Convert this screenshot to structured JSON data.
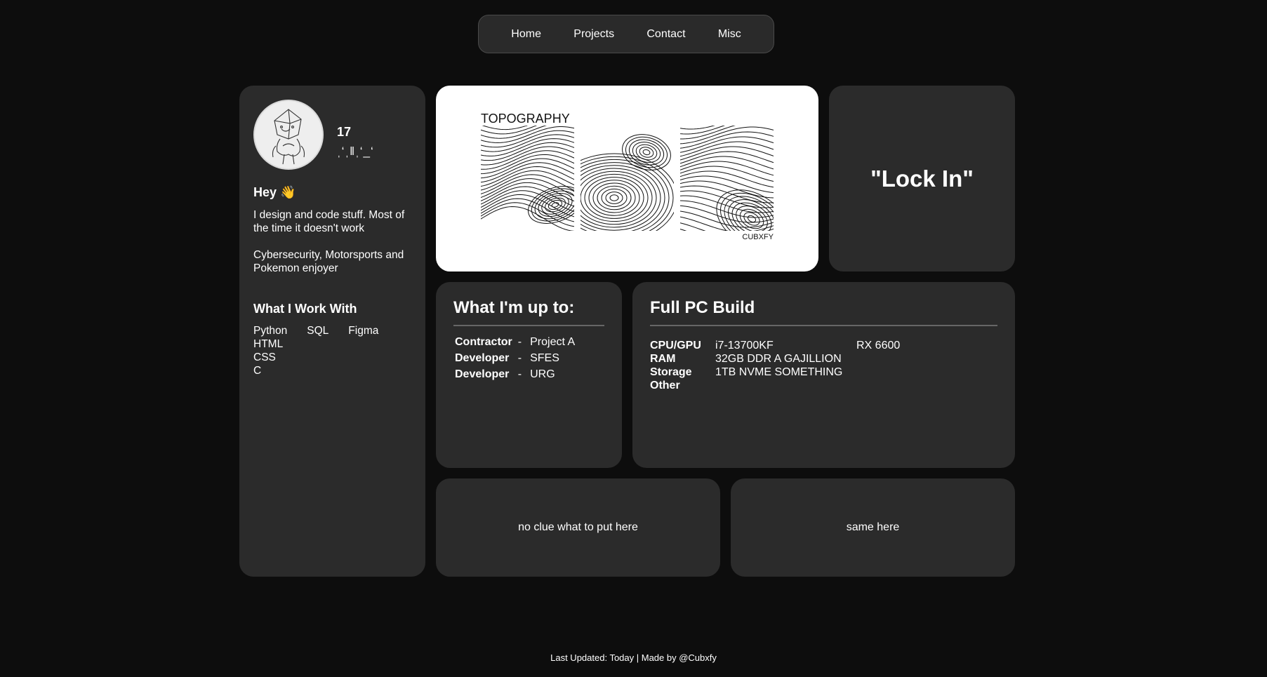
{
  "nav": [
    "Home",
    "Projects",
    "Contact",
    "Misc"
  ],
  "profile": {
    "age": "17",
    "glyph": "ˌ‘ˌ‖ˌ‘_‘",
    "greeting": "Hey 👋",
    "bio_1": "I design and code stuff. Most of the time it doesn't work",
    "bio_2": "Cybersecurity, Motorsports and Pokemon enjoyer",
    "work_title": "What I Work With",
    "skills_row": [
      "Python",
      "SQL",
      "Figma"
    ],
    "skills_col": [
      "HTML",
      "CSS",
      "C"
    ]
  },
  "topography": {
    "title": "TOPOGRAPHY",
    "credit": "CUBXFY"
  },
  "lock": {
    "text": "\"Lock In\""
  },
  "up_to": {
    "title": "What I'm up to:",
    "items": [
      {
        "role": "Contractor",
        "dash": "-",
        "project": "Project A"
      },
      {
        "role": "Developer",
        "dash": "-",
        "project": "SFES"
      },
      {
        "role": "Developer",
        "dash": "-",
        "project": "URG"
      }
    ]
  },
  "pc_build": {
    "title": "Full PC Build",
    "specs": [
      {
        "label": "CPU/GPU",
        "value": "i7-13700KF",
        "extra": "RX 6600"
      },
      {
        "label": "RAM",
        "value": "32GB DDR A GAJILLION",
        "extra": ""
      },
      {
        "label": "Storage",
        "value": "1TB NVME SOMETHING",
        "extra": ""
      },
      {
        "label": "Other",
        "value": "",
        "extra": ""
      }
    ]
  },
  "bottom_left": {
    "text": "no clue what to put here"
  },
  "bottom_right": {
    "text": "same here"
  },
  "footer": {
    "text": "Last Updated: Today | Made by @Cubxfy"
  }
}
